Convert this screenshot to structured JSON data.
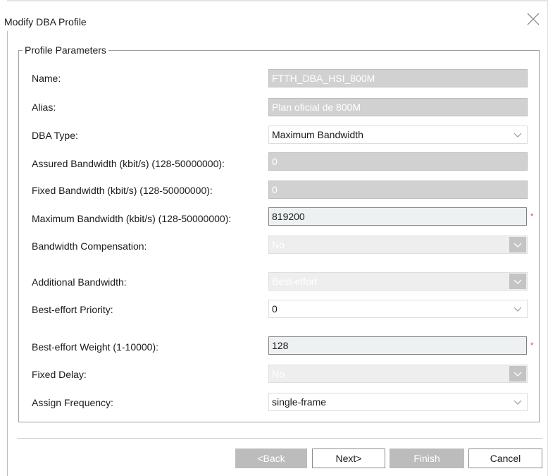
{
  "dialog": {
    "title": "Modify DBA Profile",
    "group_title": "Profile Parameters",
    "fields": {
      "name": {
        "label": "Name:",
        "value": "FTTH_DBA_HSI_800M"
      },
      "alias": {
        "label": "Alias:",
        "value": "Plan oficial de 800M"
      },
      "dba_type": {
        "label": "DBA Type:",
        "value": "Maximum Bandwidth"
      },
      "assured_bw": {
        "label": "Assured Bandwidth (kbit/s) (128-50000000):",
        "value": "0"
      },
      "fixed_bw": {
        "label": "Fixed Bandwidth (kbit/s) (128-50000000):",
        "value": "0"
      },
      "max_bw": {
        "label": "Maximum Bandwidth (kbit/s) (128-50000000):",
        "value": "819200",
        "required_mark": "*"
      },
      "bw_comp": {
        "label": "Bandwidth Compensation:",
        "value": "No"
      },
      "add_bw": {
        "label": "Additional Bandwidth:",
        "value": "Best-effort"
      },
      "be_priority": {
        "label": "Best-effort Priority:",
        "value": "0"
      },
      "be_weight": {
        "label": "Best-effort Weight (1-10000):",
        "value": "128",
        "required_mark": "*"
      },
      "fixed_delay": {
        "label": "Fixed Delay:",
        "value": "No"
      },
      "assign_freq": {
        "label": "Assign Frequency:",
        "value": "single-frame"
      }
    },
    "buttons": {
      "back": "<Back",
      "next": "Next>",
      "finish": "Finish",
      "cancel": "Cancel"
    }
  }
}
